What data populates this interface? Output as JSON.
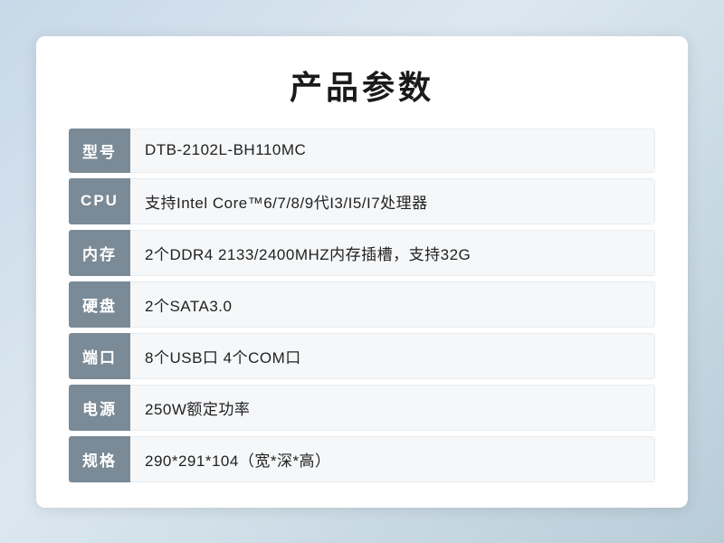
{
  "page": {
    "title": "产品参数",
    "rows": [
      {
        "label": "型号",
        "value": "DTB-2102L-BH110MC"
      },
      {
        "label": "CPU",
        "value": "支持Intel Core™6/7/8/9代I3/I5/I7处理器"
      },
      {
        "label": "内存",
        "value": "2个DDR4 2133/2400MHZ内存插槽，支持32G"
      },
      {
        "label": "硬盘",
        "value": "2个SATA3.0"
      },
      {
        "label": "端口",
        "value": "8个USB口 4个COM口"
      },
      {
        "label": "电源",
        "value": "250W额定功率"
      },
      {
        "label": "规格",
        "value": "290*291*104（宽*深*高）"
      }
    ]
  }
}
